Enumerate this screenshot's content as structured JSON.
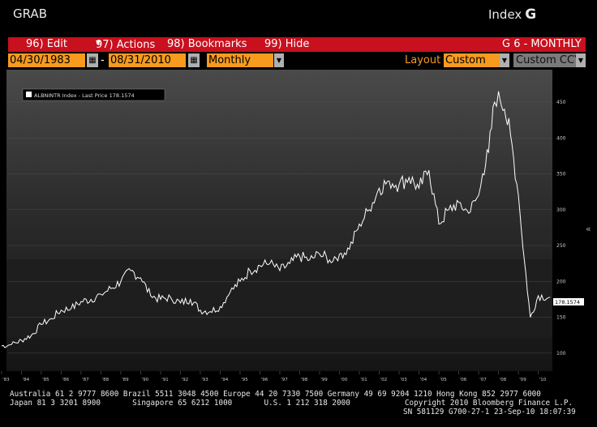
{
  "header": {
    "title": "GRAB",
    "index_label": "Index",
    "index_key": "G"
  },
  "menu": {
    "edit": "96) Edit",
    "actions": "97) Actions",
    "bookmarks": "98) Bookmarks",
    "hide": "99) Hide",
    "view_id": "G 6 - MONTHLY"
  },
  "controls": {
    "start_date": "04/30/1983",
    "separator": "-",
    "end_date": "08/31/2010",
    "period": "Monthly",
    "layout_label": "Layout",
    "layout_value": "Custom",
    "currency": "Custom CCY"
  },
  "legend": {
    "text": "ALBNINTR Index - Last Price 178.1574"
  },
  "last_price_tag": "178.1574",
  "colors": {
    "menu_red": "#c8101e",
    "field_orange": "#f79a1e",
    "line": "#ffffff"
  },
  "chart_data": {
    "type": "line",
    "series": [
      {
        "name": "ALBNINTR Index - Last Price",
        "x": [
          "1983",
          "1983.5",
          "1984",
          "1984.5",
          "1985",
          "1985.5",
          "1986",
          "1986.5",
          "1987",
          "1987.5",
          "1988",
          "1988.5",
          "1989",
          "1989.5",
          "1990",
          "1990.5",
          "1991",
          "1991.5",
          "1992",
          "1992.5",
          "1993",
          "1993.5",
          "1994",
          "1994.5",
          "1995",
          "1995.5",
          "1996",
          "1996.5",
          "1997",
          "1997.5",
          "1998",
          "1998.5",
          "1999",
          "1999.5",
          "2000",
          "2000.5",
          "2001",
          "2001.5",
          "2002",
          "2002.5",
          "2003",
          "2003.5",
          "2004",
          "2004.5",
          "2005",
          "2005.5",
          "2006",
          "2006.5",
          "2007",
          "2007.2",
          "2007.5",
          "2007.8",
          "2008",
          "2008.3",
          "2008.6",
          "2009",
          "2009.3",
          "2009.6",
          "2010",
          "2010.6"
        ],
        "values": [
          110,
          112,
          118,
          125,
          140,
          148,
          160,
          162,
          172,
          175,
          182,
          190,
          200,
          215,
          205,
          180,
          175,
          178,
          170,
          175,
          160,
          158,
          165,
          185,
          200,
          215,
          222,
          225,
          215,
          225,
          235,
          230,
          238,
          230,
          238,
          245,
          280,
          300,
          330,
          340,
          335,
          345,
          330,
          355,
          280,
          300,
          310,
          295,
          320,
          350,
          380,
          450,
          465,
          440,
          405,
          320,
          230,
          150,
          180,
          178
        ]
      }
    ],
    "x_tick_labels": [
      "'83",
      "'84",
      "'85",
      "'86",
      "'87",
      "'88",
      "'89",
      "'90",
      "'91",
      "'92",
      "'93",
      "'94",
      "'95",
      "'96",
      "'97",
      "'98",
      "'99",
      "'00",
      "'01",
      "'02",
      "'03",
      "'04",
      "'05",
      "'06",
      "'07",
      "'08",
      "'09",
      "'10"
    ],
    "y_tick_labels": [
      "100",
      "150",
      "200",
      "250",
      "300",
      "350",
      "400",
      "450"
    ],
    "ylim": [
      75,
      485
    ]
  },
  "footer": {
    "line1": "Australia 61 2 9777 8600 Brazil 5511 3048 4500 Europe 44 20 7330 7500 Germany 49 69 9204 1210 Hong Kong 852 2977 6000",
    "line2": "Japan 81 3 3201 8900       Singapore 65 6212 1000       U.S. 1 212 318 2000            Copyright 2010 Bloomberg Finance L.P.",
    "line3": "SN 581129 G700-27-1 23-Sep-10 18:07:39"
  }
}
